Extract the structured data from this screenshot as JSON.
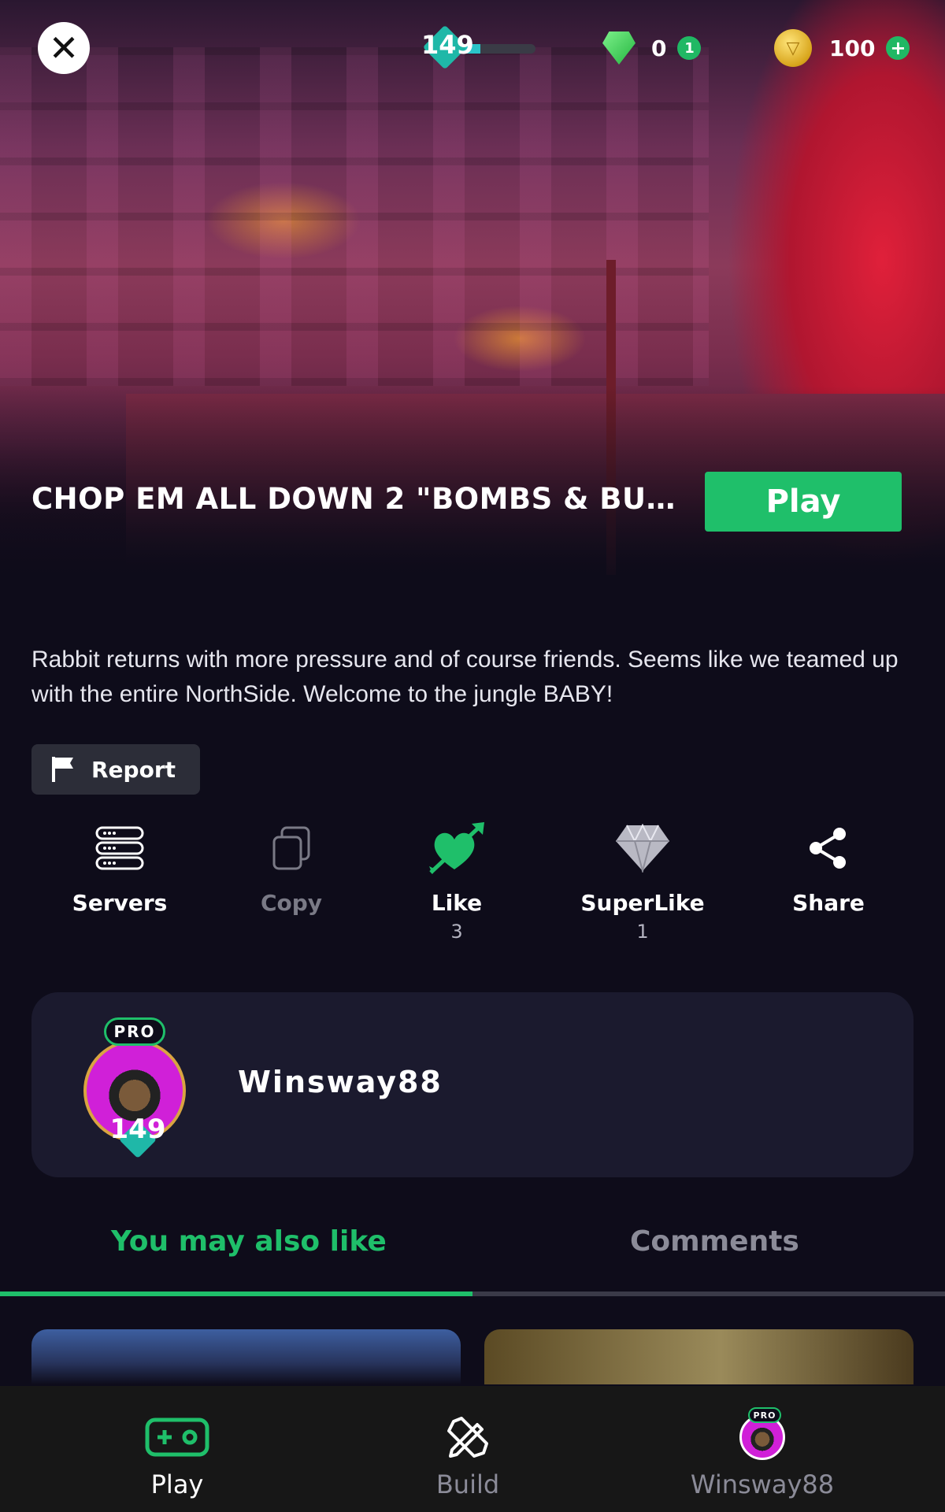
{
  "hud": {
    "level": "149",
    "level_progress_fraction": 0.3,
    "gems": "0",
    "gem_badge": "1",
    "coins": "100",
    "coin_plus": "+"
  },
  "game": {
    "title": "CHOP EM ALL DOWN 2 \"BOMBS & BUL...",
    "play_label": "Play",
    "description": "Rabbit returns with more pressure and of course friends. Seems like we teamed up with the entire NorthSide. Welcome to the jungle BABY!",
    "report_label": "Report"
  },
  "actions": [
    {
      "label": "Servers",
      "count": "",
      "icon": "servers-icon"
    },
    {
      "label": "Copy",
      "count": "",
      "icon": "copy-icon"
    },
    {
      "label": "Like",
      "count": "3",
      "icon": "heart-arrow-icon"
    },
    {
      "label": "SuperLike",
      "count": "1",
      "icon": "diamond-icon"
    },
    {
      "label": "Share",
      "count": "",
      "icon": "share-icon"
    }
  ],
  "creator": {
    "name": "Winsway88",
    "badge": "PRO",
    "level": "149"
  },
  "tabs": {
    "active": "You may also like",
    "inactive": "Comments"
  },
  "nav": [
    {
      "label": "Play",
      "icon": "gamepad-icon"
    },
    {
      "label": "Build",
      "icon": "build-tools-icon"
    },
    {
      "label": "Winsway88",
      "icon": "avatar-icon",
      "badge": "PRO"
    }
  ],
  "colors": {
    "accent": "#1fbf6a",
    "background": "#0e0c1a",
    "card": "#1b1a2e"
  }
}
